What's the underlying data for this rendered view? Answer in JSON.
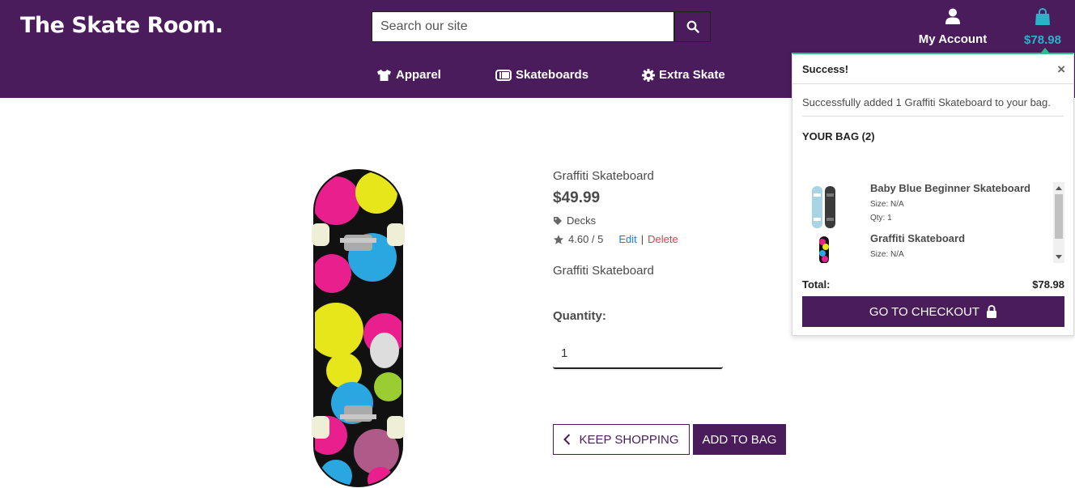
{
  "header": {
    "logo": "The Skate Room.",
    "search_placeholder": "Search our site",
    "account_label": "My Account",
    "bag_total": "$78.98"
  },
  "nav": {
    "items": [
      {
        "label": "Apparel",
        "icon": "tshirt-icon"
      },
      {
        "label": "Skateboards",
        "icon": "skateboard-icon"
      },
      {
        "label": "Extra Skate",
        "icon": "gear-icon"
      }
    ]
  },
  "product": {
    "title": "Graffiti Skateboard",
    "price": "$49.99",
    "category": "Decks",
    "rating": "4.60 / 5",
    "edit_label": "Edit",
    "separator": "|",
    "delete_label": "Delete",
    "description": "Graffiti Skateboard",
    "quantity_label": "Quantity:",
    "quantity_value": "1",
    "keep_shopping_label": "KEEP SHOPPING",
    "add_to_bag_label": "ADD TO BAG"
  },
  "popup": {
    "title": "Success!",
    "close": "×",
    "message": "Successfully added 1 Graffiti Skateboard to your bag.",
    "bag_title": "YOUR BAG (2)",
    "items": [
      {
        "name": "Baby Blue Beginner Skateboard",
        "size": "Size: N/A",
        "qty": "Qty: 1"
      },
      {
        "name": "Graffiti Skateboard",
        "size": "Size: N/A"
      }
    ],
    "total_label": "Total:",
    "total_value": "$78.98",
    "checkout_label": "GO TO CHECKOUT"
  },
  "colors": {
    "brand_purple": "#4a1c5c",
    "bag_accent": "#2ab3c9",
    "success_green": "#2fbf8f",
    "edit_blue": "#1f7be0",
    "delete_red": "#e23b4b"
  }
}
